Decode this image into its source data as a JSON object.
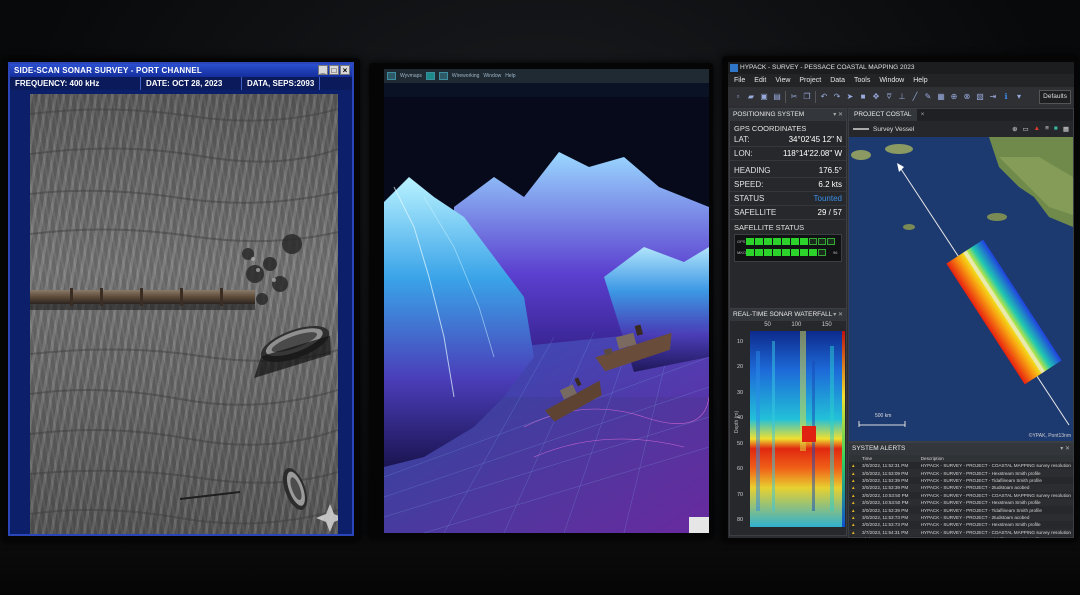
{
  "monitor_left": {
    "title": "SIDE-SCAN SONAR SURVEY - PORT CHANNEL",
    "frequency": "FREQUENCY: 400 kHz",
    "date": "DATE: OCT 28, 2023",
    "data": "DATA, SEPS:2093",
    "window_buttons": [
      "_",
      "□",
      "×"
    ]
  },
  "monitor_middle": {
    "menu": [
      "Wyvmaps",
      "Wireworking",
      "Window",
      "Help"
    ]
  },
  "monitor_right": {
    "app_title": "HYPACK - SURVEY - PESSACE COASTAL MAPPING 2023",
    "menu": [
      "File",
      "Edit",
      "View",
      "Project",
      "Data",
      "Tools",
      "Window",
      "Help"
    ],
    "defaults_label": "Defaults",
    "positioning": {
      "header": "POSITIONING SYSTEM",
      "gps_label": "GPS COORDINATES",
      "lat_label": "LAT:",
      "lat_value": "34°02'45 12\" N",
      "lon_label": "LON:",
      "lon_value": "118°14'22.08\" W",
      "heading_label": "HEADING",
      "heading_value": "176.5°",
      "speed_label": "SPEED:",
      "speed_value": "6.2 kts",
      "status_label": "STATUS",
      "status_value": "Tounted",
      "satellite_label": "SAFELLITE",
      "satellite_value": "29 / 57",
      "sat_status_label": "SAFELLITE STATUS",
      "gps_row_label": "GPS",
      "glonass_row_label": "MKOH",
      "gps_count": "96",
      "glonass_count": "96"
    },
    "waterfall": {
      "header": "REAL-TIME SONAR WATERFALL",
      "x_ticks": [
        "50",
        "100",
        "150"
      ],
      "y_ticks": [
        "10",
        "20",
        "30",
        "40",
        "50",
        "60",
        "70",
        "80"
      ],
      "y_label": "Depth (m)"
    },
    "project": {
      "tab": "PROJECT COSTAL",
      "vessel_label": "Survey Vessel",
      "scale_label": "500 km",
      "attribution": "©YPAK, Pont13nm"
    },
    "alerts": {
      "header": "SYSTEM ALERTS",
      "columns": [
        "Time",
        "Description"
      ],
      "rows": [
        {
          "time": "3/0/2022, 11:52:31 PM",
          "desc": "HYPACK - SURVEY - PROJECT - COASTAL MAPPING survey resolution"
        },
        {
          "time": "3/0/2022, 11:53:09 PM",
          "desc": "HYPACK - SURVEY - PROJECT - Hexstream Smith profile"
        },
        {
          "time": "3/0/2022, 11:53:39 PM",
          "desc": "HYPACK - SURVEY - PROJECT - Tidaflineam Smith profile"
        },
        {
          "time": "3/0/2022, 11:53:39 PM",
          "desc": "HYPACK - SURVEY - PROJECT - 2tudstoam acobed"
        },
        {
          "time": "3/0/2022, 10:53:50 PM",
          "desc": "HYPACK - SURVEY - PROJECT - COASTAL MAPPING survey resolution"
        },
        {
          "time": "3/0/2022, 10:53:50 PM",
          "desc": "HYPACK - SURVEY - PROJECT - Hexstream Smith profile"
        },
        {
          "time": "3/0/2022, 11:53:39 PM",
          "desc": "HYPACK - SURVEY - PROJECT - Tidaflineam Smith profile"
        },
        {
          "time": "3/0/2022, 11:53:73 PM",
          "desc": "HYPACK - SURVEY - PROJECT - 2tudstoam acobed"
        },
        {
          "time": "3/0/2022, 11:53:73 PM",
          "desc": "HYPACK - SURVEY - PROJECT - Hexstream Smith profile"
        },
        {
          "time": "3/7/2023, 11:54:31 PM",
          "desc": "HYPACK - SURVEY - PROJECT - COASTAL MAPPING survey resolution"
        },
        {
          "time": "3/7/2023, 11:54:63 PM",
          "desc": "HYPACK - SURVEY - PROJECT - Tidaflineam Smith profile"
        },
        {
          "time": "3/7/2023, 11:54:41 PM",
          "desc": "HYPACK - SURVEY - PROJECT - Eltstream wilh profile"
        }
      ]
    },
    "colors": {
      "accent": "#2f76c8",
      "gps_green": "#2bd32b",
      "alert_yellow": "#e2b32a"
    }
  }
}
